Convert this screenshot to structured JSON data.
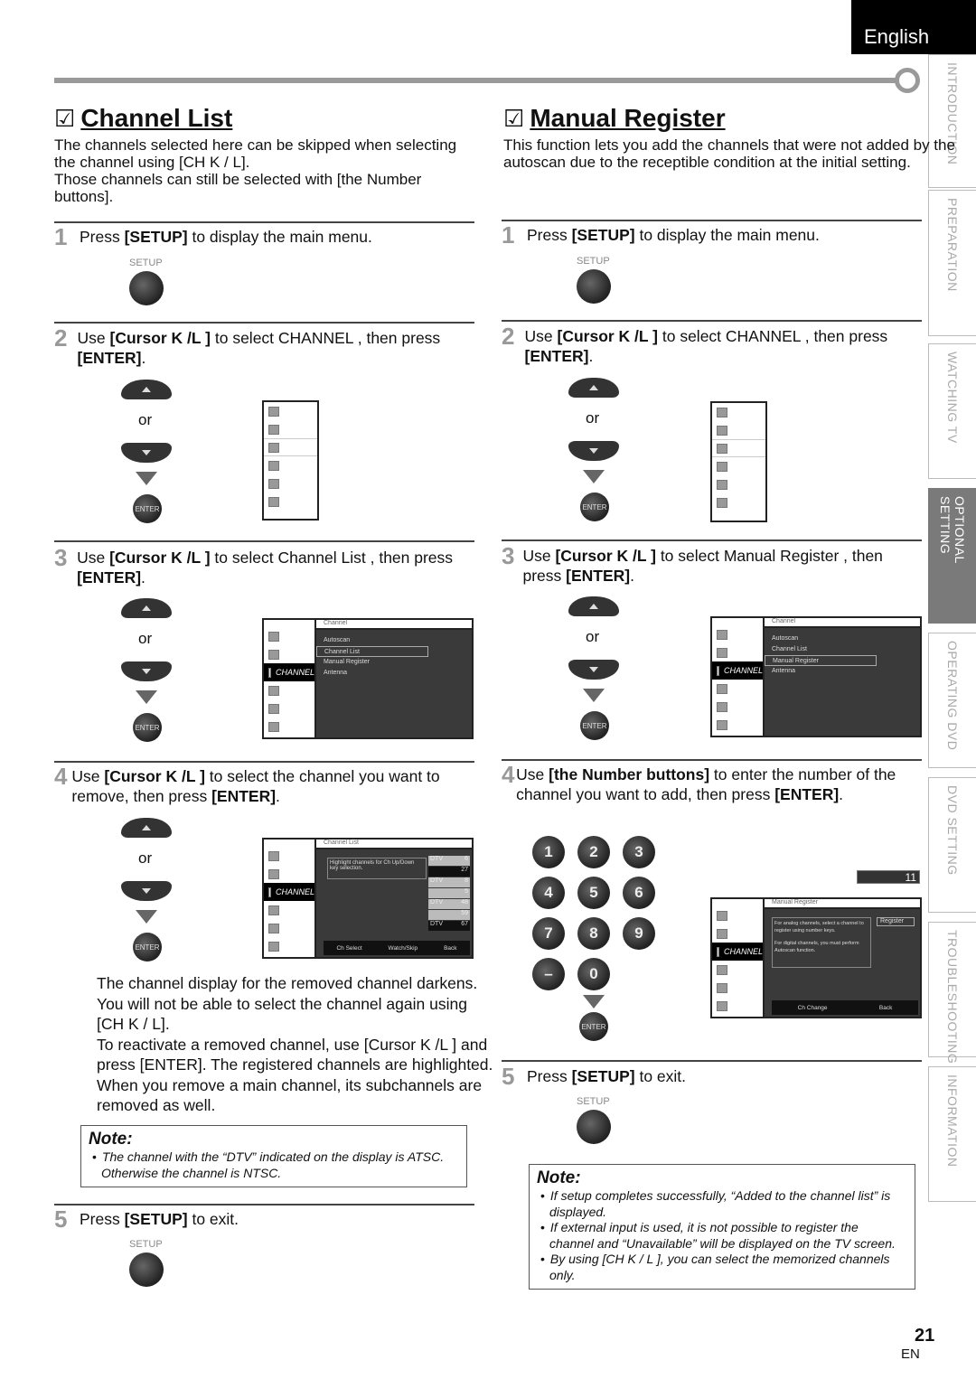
{
  "header": {
    "language": "English",
    "page_number": "21",
    "page_lang": "EN"
  },
  "side_tabs": [
    {
      "label": "INTRODUCTION",
      "active": false
    },
    {
      "label": "PREPARATION",
      "active": false
    },
    {
      "label": "WATCHING  TV",
      "active": false
    },
    {
      "label": "OPTIONAL  SETTING",
      "active": true
    },
    {
      "label": "OPERATING  DVD",
      "active": false
    },
    {
      "label": "DVD  SETTING",
      "active": false
    },
    {
      "label": "TROUBLESHOOTING",
      "active": false
    },
    {
      "label": "INFORMATION",
      "active": false
    }
  ],
  "channel_list": {
    "title": "Channel List",
    "check": "☑",
    "intro_1": " The channels selected here can be skipped when selecting the channel using [CH K / L].",
    "intro_2": "Those channels can still be selected with [the Number buttons].",
    "step1": {
      "num": "1",
      "pre": "Press ",
      "key": "[SETUP]",
      "post": " to display the main menu.",
      "button": "SETUP"
    },
    "step2": {
      "num": "2",
      "pre": "Use ",
      "key": "[Cursor K /L ]",
      "post": " to select  CHANNEL , then press ",
      "key2": "[ENTER]",
      "post2": "."
    },
    "step3": {
      "num": "3",
      "pre": "Use ",
      "key": "[Cursor K /L ]",
      "post": " to select  Channel List , then press ",
      "key2": "[ENTER]",
      "post2": "."
    },
    "step4": {
      "num": "4",
      "pre": "Use ",
      "key": "[Cursor K /L ]",
      "post": " to select the channel you want to remove, then press ",
      "key2": "[ENTER]",
      "post2": "."
    },
    "step4_text": [
      "The channel display for the removed channel darkens. You will not be able to select the channel again using [CH K / L].",
      "To reactivate a removed channel, use [Cursor K /L ] and press [ENTER]. The registered channels are highlighted.",
      "When you remove a main channel, its subchannels are removed as well."
    ],
    "note_title": "Note:",
    "notes": [
      "The channel with the “DTV” indicated on the display is ATSC. Otherwise the channel is NTSC."
    ],
    "step5": {
      "num": "5",
      "pre": "Press ",
      "key": "[SETUP]",
      "post": " to exit.",
      "button": "SETUP"
    }
  },
  "manual_register": {
    "title": "Manual Register",
    "check": "☑",
    "intro": "This function lets you add the channels that were not added by the autoscan due to the receptible condition at the initial setting.",
    "step1": {
      "num": "1",
      "pre": "Press ",
      "key": "[SETUP]",
      "post": " to display the main menu.",
      "button": "SETUP"
    },
    "step2": {
      "num": "2",
      "pre": "Use ",
      "key": "[Cursor K /L ]",
      "post": " to select  CHANNEL , then press ",
      "key2": "[ENTER]",
      "post2": "."
    },
    "step3": {
      "num": "3",
      "pre": "Use ",
      "key": "[Cursor K /L ]",
      "post": " to select  Manual Register , then press ",
      "key2": "[ENTER]",
      "post2": "."
    },
    "step4": {
      "num": "4",
      "pre": "Use ",
      "key": "[the Number buttons]",
      "post": " to enter the number of the channel you want to add, then press ",
      "key2": "[ENTER]",
      "post2": "."
    },
    "numpad": [
      "1",
      "2",
      "3",
      "4",
      "5",
      "6",
      "7",
      "8",
      "9",
      "–",
      "0"
    ],
    "channel_display": "11",
    "step5": {
      "num": "5",
      "pre": "Press ",
      "key": "[SETUP]",
      "post": " to exit.",
      "button": "SETUP"
    },
    "note_title": "Note:",
    "notes": [
      "If setup completes successfully, “Added to the channel list” is displayed.",
      "If external input is used, it is not possible to register the channel and “Unavailable” will be displayed on the TV screen.",
      "By using [CH K / L ], you can select the memorized channels only."
    ]
  },
  "remote": {
    "or": "or",
    "enter": "ENTER"
  },
  "osd": {
    "channel_label": "CHANNEL",
    "channel_menu": {
      "header": "Channel",
      "options": [
        "Autoscan",
        "Channel List",
        "Manual Register",
        "Antenna"
      ]
    },
    "channel_list_screen": {
      "header": "Channel List",
      "help": "Highlight channels for Ch Up/Down key selection.",
      "channels": [
        {
          "type": "DTV",
          "num": "6"
        },
        {
          "type": "",
          "num": "27"
        },
        {
          "type": "DTV",
          "num": "8"
        },
        {
          "type": "",
          "num": "5"
        },
        {
          "type": "DTV",
          "num": "48"
        },
        {
          "type": "",
          "num": "59"
        },
        {
          "type": "DTV",
          "num": "67"
        }
      ],
      "footer": [
        "Ch Select",
        "Watch/Skip",
        "Back"
      ]
    },
    "manual_register_screen": {
      "header": "Manual Register",
      "help_1": "For analog channels, select a channel to register using number keys.",
      "help_2": "For digital channels, you must perform Autoscan function.",
      "register_button": "Register",
      "footer": [
        "Ch Change",
        "Back"
      ]
    }
  }
}
